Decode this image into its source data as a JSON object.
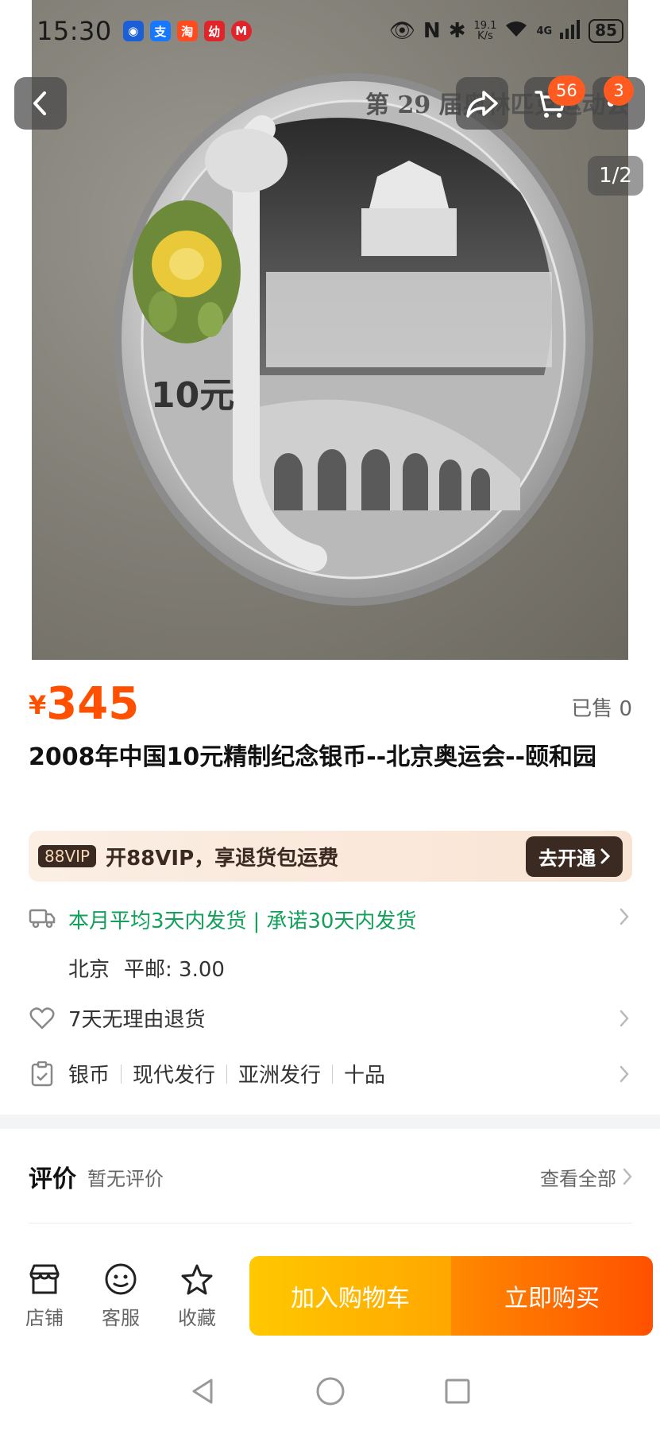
{
  "status_bar": {
    "time": "15:30",
    "net_speed_value": "19.1",
    "net_speed_unit": "K/s",
    "network": "4G",
    "battery": "85"
  },
  "hero": {
    "page_counter": "1/2",
    "cart_badge": "56",
    "more_badge": "3",
    "coin_top_text": "第 29 届奥林匹克运动会",
    "coin_denomination": "10元"
  },
  "product": {
    "currency": "¥",
    "price": "345",
    "sold": "已售 0",
    "title": "2008年中国10元精制纪念银币--北京奥运会--颐和园"
  },
  "vip": {
    "tag": "88VIP",
    "text": "开88VIP，享退货包运费",
    "button": "去开通"
  },
  "shipping": {
    "line1_part1": "本月平均3天内发货",
    "separator": "|",
    "line1_part2": "承诺30天内发货",
    "origin": "北京",
    "postage": "平邮: 3.00"
  },
  "returns": {
    "text": "7天无理由退货"
  },
  "tags": [
    "银币",
    "现代发行",
    "亚洲发行",
    "十品"
  ],
  "reviews": {
    "title": "评价",
    "subtitle": "暂无评价",
    "link": "查看全部"
  },
  "action_bar": {
    "shop": "店铺",
    "service": "客服",
    "favorite": "收藏",
    "add_to_cart": "加入购物车",
    "buy_now": "立即购买"
  },
  "colors": {
    "accent": "#ff5000",
    "ship_green": "#12a05a",
    "cart_yellow": "#ffb800"
  }
}
